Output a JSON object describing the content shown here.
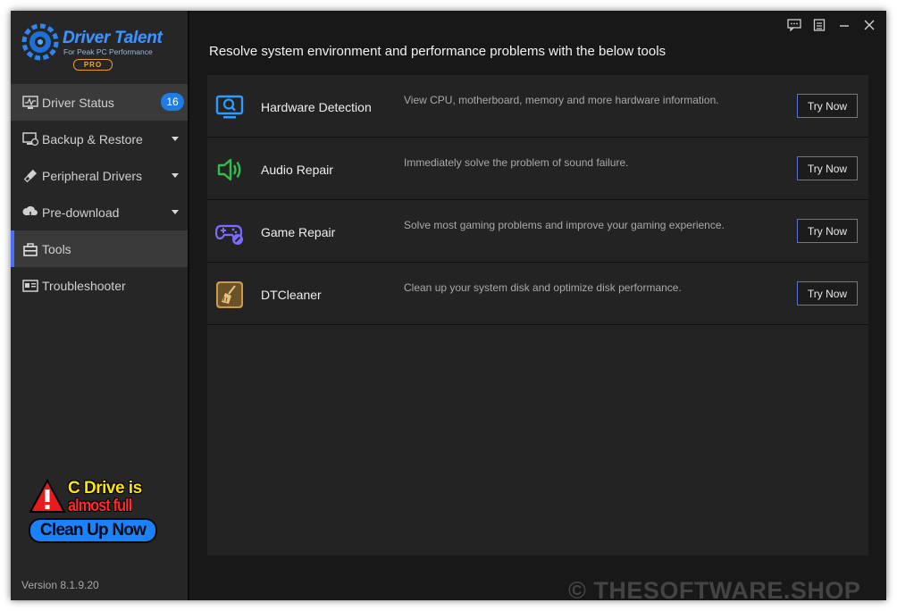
{
  "app": {
    "brand": "Driver Talent",
    "tagline": "For Peak PC Performance",
    "edition": "PRO",
    "version": "Version 8.1.9.20"
  },
  "sidebar": {
    "items": [
      {
        "label": "Driver Status",
        "icon": "monitor-pulse-icon",
        "badge": "16"
      },
      {
        "label": "Backup & Restore",
        "icon": "backup-restore-icon"
      },
      {
        "label": "Peripheral Drivers",
        "icon": "usb-plug-icon"
      },
      {
        "label": "Pre-download",
        "icon": "download-cloud-icon"
      },
      {
        "label": "Tools",
        "icon": "toolbox-icon"
      },
      {
        "label": "Troubleshooter",
        "icon": "troubleshoot-screen-icon"
      }
    ]
  },
  "promo": {
    "line1": "C Drive is",
    "line2": "almost full",
    "cta": "Clean Up Now",
    "colors": {
      "line1": "#ffe600",
      "line2": "#ff2a2a",
      "button": "#1a82ff"
    }
  },
  "main": {
    "heading": "Resolve system environment and performance problems with the below tools",
    "tools": [
      {
        "name": "Hardware Detection",
        "description": "View CPU, motherboard, memory and more hardware information.",
        "button": "Try Now",
        "icon": "monitor-search-icon",
        "color": "#2f9bff"
      },
      {
        "name": "Audio Repair",
        "description": "Immediately solve the problem of sound failure.",
        "button": "Try Now",
        "icon": "speaker-icon",
        "color": "#2fbf4a"
      },
      {
        "name": "Game Repair",
        "description": "Solve most gaming problems and improve your gaming experience.",
        "button": "Try Now",
        "icon": "gamepad-wrench-icon",
        "color": "#7a6cff"
      },
      {
        "name": "DTCleaner",
        "description": "Clean up your system disk and optimize disk performance.",
        "button": "Try Now",
        "icon": "broom-icon",
        "color": "#d6a657"
      }
    ]
  },
  "window_controls": [
    "feedback-icon",
    "menu-icon",
    "minimize-icon",
    "close-icon"
  ],
  "watermark": "© THESOFTWARE.SHOP"
}
